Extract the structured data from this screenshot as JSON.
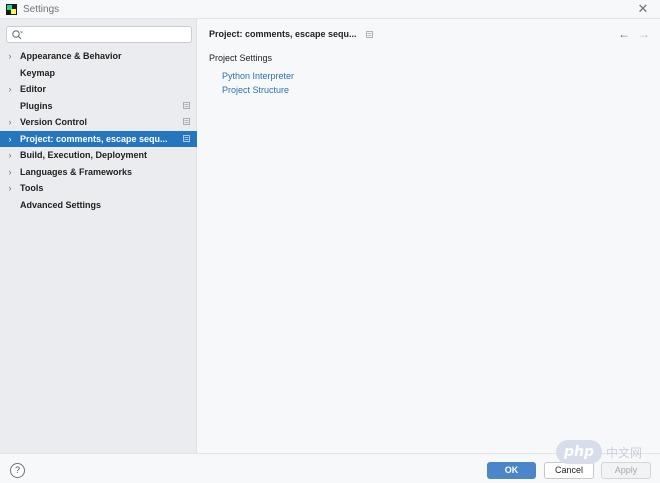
{
  "window": {
    "title": "Settings",
    "close_glyph": "✕"
  },
  "search": {
    "placeholder": "",
    "value": ""
  },
  "sidebar": {
    "items": [
      {
        "label": "Appearance & Behavior",
        "expandable": true,
        "badge": false,
        "selected": false
      },
      {
        "label": "Keymap",
        "expandable": false,
        "badge": false,
        "selected": false
      },
      {
        "label": "Editor",
        "expandable": true,
        "badge": false,
        "selected": false
      },
      {
        "label": "Plugins",
        "expandable": false,
        "badge": true,
        "selected": false
      },
      {
        "label": "Version Control",
        "expandable": true,
        "badge": true,
        "selected": false
      },
      {
        "label": "Project: comments, escape sequ...",
        "expandable": true,
        "badge": true,
        "selected": true
      },
      {
        "label": "Build, Execution, Deployment",
        "expandable": true,
        "badge": false,
        "selected": false
      },
      {
        "label": "Languages & Frameworks",
        "expandable": true,
        "badge": false,
        "selected": false
      },
      {
        "label": "Tools",
        "expandable": true,
        "badge": false,
        "selected": false
      },
      {
        "label": "Advanced Settings",
        "expandable": false,
        "badge": false,
        "selected": false
      }
    ]
  },
  "main": {
    "breadcrumb": "Project: comments, escape sequ...",
    "back_glyph": "←",
    "forward_glyph": "→",
    "section_title": "Project Settings",
    "links": [
      "Python Interpreter",
      "Project Structure"
    ]
  },
  "footer": {
    "help_label": "?",
    "ok_label": "OK",
    "cancel_label": "Cancel",
    "apply_label": "Apply"
  },
  "watermark": {
    "logo_text": "php",
    "text": "中文网"
  },
  "colors": {
    "accent": "#2675bf",
    "link": "#2f6fb5",
    "ok_button": "#4a86c8"
  },
  "icons": {
    "app": "pycharm-icon",
    "search": "search-icon",
    "chevron": "chevron-right-icon",
    "badge": "project-level-icon"
  }
}
